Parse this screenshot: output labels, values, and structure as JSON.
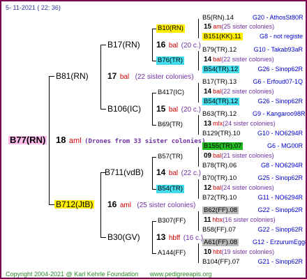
{
  "header": {
    "date": "5- 11-2021 ( 22: 36)"
  },
  "footer": {
    "copyright": "Copyright 2004-2021 @ Karl Kehrle Foundation",
    "site": "www.pedigreeapis.org"
  },
  "root": {
    "name": "B77(RN)",
    "bee": "aml",
    "num": "18",
    "drones": "(Drones from 33 sister colonies)"
  },
  "gen1": {
    "top": {
      "name": "B81(RN)",
      "num": "17",
      "bee": "bal",
      "sisters": "(22 sister colonies)"
    },
    "bottom": {
      "name": "B712(JtB)",
      "num": "16",
      "bee": "aml",
      "sisters": "(25 sister colonies)"
    }
  },
  "gen2": {
    "a": {
      "name": "B17(RN)"
    },
    "b": {
      "name": "B106(IC)"
    },
    "c": {
      "name": "B711(vdB)",
      "num": "14",
      "bee": "bal",
      "sisters": "(22 c.)"
    },
    "d": {
      "name": "B30(GV)"
    }
  },
  "gen3": {
    "a1": {
      "name": "B10(RN)"
    },
    "a": {
      "num": "16",
      "bee": "bal",
      "sisters": "(20 c.)"
    },
    "a2": {
      "name": "B76(TR)"
    },
    "b1": {
      "name": "B417(IC)"
    },
    "b": {
      "num": "15",
      "bee": "bal",
      "sisters": "(20 c.)"
    },
    "b2": {
      "name": "B69(TR)"
    },
    "c1": {
      "name": "B57(TR)"
    },
    "c2": {
      "name": "B54(TR)"
    },
    "d1": {
      "name": "B307(FF)"
    },
    "d": {
      "num": "13",
      "bee": "hbff",
      "sisters": "(16 c.)"
    },
    "d2": {
      "name": "A144(FF)"
    }
  },
  "leaves": [
    {
      "name": "B5(RN).14",
      "info": "G20 - AthosSt80R"
    },
    {
      "num": "15",
      "bee": "am",
      "sisters": "(25 sister colonies)"
    },
    {
      "name": "B151(KK).11",
      "info": "G8 - not registe"
    },
    {
      "name": "B79(TR).12",
      "info": "G10 - Takab93aR"
    },
    {
      "num": "14",
      "bee": "bal",
      "sisters": "(22 sister colonies)"
    },
    {
      "name": "B54(TR).12",
      "info": "G26 - Sinop62R"
    },
    {
      "name": "B17(TR).13",
      "info": "G6 - Erfoud07-1Q"
    },
    {
      "num": "14",
      "bee": "bal",
      "sisters": "(22 sister colonies)"
    },
    {
      "name": "B54(TR).12",
      "info": "G26 - Sinop62R"
    },
    {
      "name": "B63(TR).12",
      "info": "G9 - Kangaroo98R"
    },
    {
      "num": "13",
      "bee": "mlx",
      "sisters": "(24 sister colonies)"
    },
    {
      "name": "B129(TR).10",
      "info": "G10 - NO6294R"
    },
    {
      "name": "B155(TR).07",
      "info": "G6 - MG00R"
    },
    {
      "num": "09",
      "bee": "bal",
      "sisters": "(21 sister colonies)"
    },
    {
      "name": "B78(TR).06",
      "info": "G8 - NO6294R"
    },
    {
      "name": "B70(TR).10",
      "info": "G25 - Sinop62R"
    },
    {
      "num": "12",
      "bee": "bal",
      "sisters": "(24 sister colonies)"
    },
    {
      "name": "B72(TR).10",
      "info": "G11 - NO6294R"
    },
    {
      "name": "B62(FF).08",
      "info": "G22 - Sinop62R"
    },
    {
      "num": "11",
      "bee": "hbx",
      "sisters": "(16 sister colonies)"
    },
    {
      "name": "B58(FF).07",
      "info": "G22 - Sinop62R"
    },
    {
      "name": "A61(FF).08",
      "info": "G12 - ErzurumEgg8"
    },
    {
      "num": "10",
      "bee": "hbt",
      "sisters": "(19 sister colonies)"
    },
    {
      "name": "B104(FF).07",
      "info": "G21 - Sinop62R"
    }
  ]
}
